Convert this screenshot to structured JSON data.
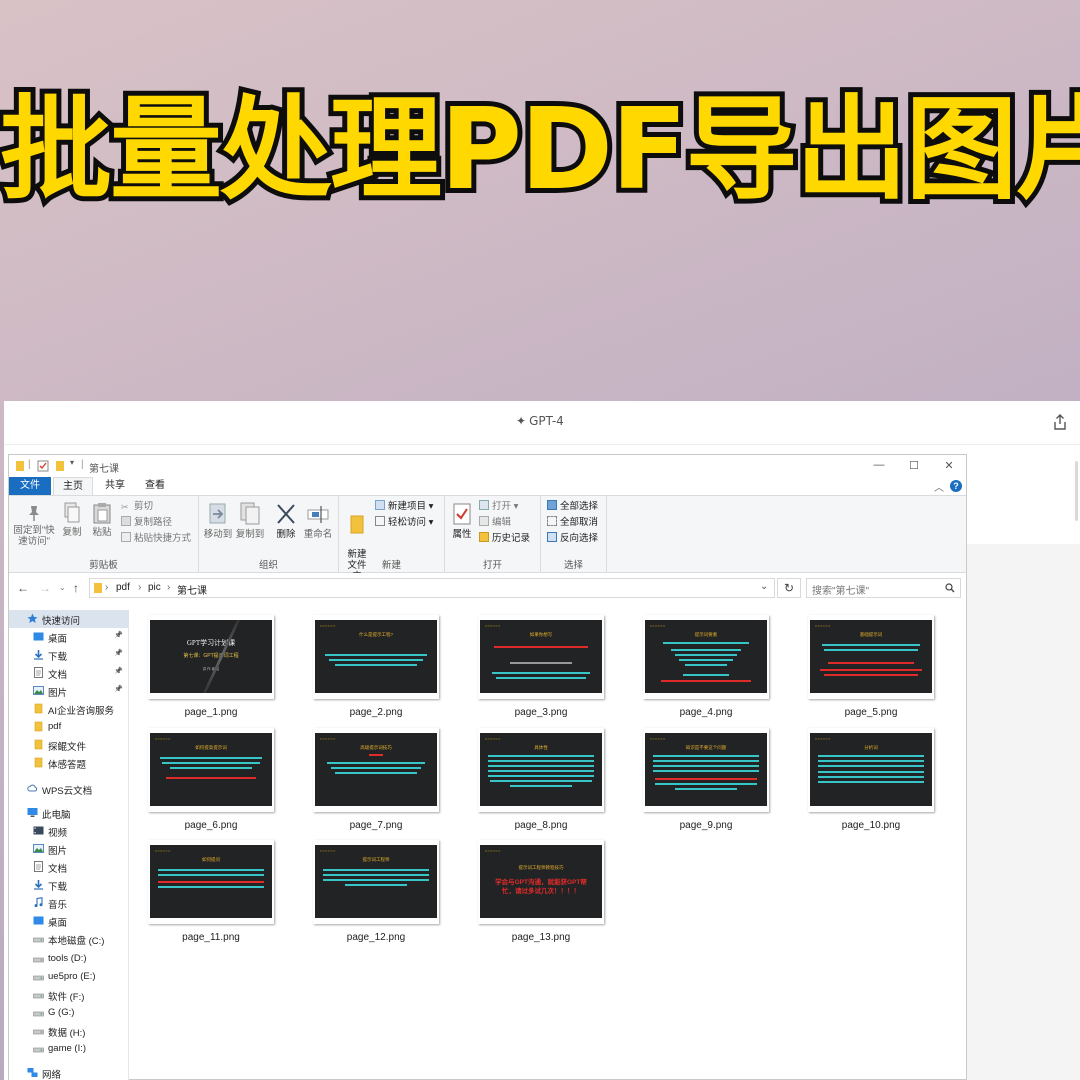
{
  "headline": "批量处理PDF导出图片",
  "app": {
    "model_label": "GPT-4",
    "model_icon": "sparkle-icon",
    "share_icon": "share-icon"
  },
  "explorer": {
    "title": "第七课",
    "tabs": [
      "文件",
      "主页",
      "共享",
      "查看"
    ],
    "ribbon": {
      "clipboard": {
        "pin_label": "固定到\"快速访问\"",
        "copy_label": "复制",
        "paste_label": "粘贴",
        "cut_label": "剪切",
        "copy_path_label": "复制路径",
        "paste_shortcut_label": "粘贴快捷方式",
        "group_label": "剪贴板"
      },
      "organize": {
        "move_to_label": "移动到",
        "copy_to_label": "复制到",
        "delete_label": "删除",
        "rename_label": "重命名",
        "group_label": "组织"
      },
      "new": {
        "new_folder_label": "新建\n文件夹",
        "new_item_label": "新建项目 ▾",
        "easy_access_label": "轻松访问 ▾",
        "group_label": "新建"
      },
      "open": {
        "properties_label": "属性",
        "open_label": "打开 ▾",
        "edit_label": "编辑",
        "history_label": "历史记录",
        "group_label": "打开"
      },
      "select": {
        "select_all_label": "全部选择",
        "select_none_label": "全部取消",
        "invert_label": "反向选择",
        "group_label": "选择"
      }
    },
    "address": {
      "crumbs": [
        "pdf",
        "pic",
        "第七课"
      ],
      "search_placeholder": "搜索\"第七课\""
    },
    "sidebar": [
      {
        "label": "快速访问",
        "icon": "star-icon",
        "pinned": false,
        "level": 0,
        "active": true
      },
      {
        "label": "桌面",
        "icon": "desktop-icon",
        "pinned": true,
        "level": 1
      },
      {
        "label": "下载",
        "icon": "download-icon",
        "pinned": true,
        "level": 1
      },
      {
        "label": "文档",
        "icon": "document-icon",
        "pinned": true,
        "level": 1
      },
      {
        "label": "图片",
        "icon": "picture-icon",
        "pinned": true,
        "level": 1
      },
      {
        "label": "AI企业咨询服务",
        "icon": "folder-icon",
        "pinned": false,
        "level": 1
      },
      {
        "label": "pdf",
        "icon": "folder-icon",
        "pinned": false,
        "level": 1
      },
      {
        "label": "探鲲文件",
        "icon": "folder-icon",
        "pinned": false,
        "level": 1
      },
      {
        "label": "体感答题",
        "icon": "folder-icon",
        "pinned": false,
        "level": 1
      },
      {
        "label": "WPS云文档",
        "icon": "cloud-icon",
        "pinned": false,
        "level": 0
      },
      {
        "label": "此电脑",
        "icon": "computer-icon",
        "pinned": false,
        "level": 0
      },
      {
        "label": "视频",
        "icon": "video-icon",
        "pinned": false,
        "level": 1
      },
      {
        "label": "图片",
        "icon": "picture-icon",
        "pinned": false,
        "level": 1
      },
      {
        "label": "文档",
        "icon": "document-icon",
        "pinned": false,
        "level": 1
      },
      {
        "label": "下载",
        "icon": "download-icon",
        "pinned": false,
        "level": 1
      },
      {
        "label": "音乐",
        "icon": "music-icon",
        "pinned": false,
        "level": 1
      },
      {
        "label": "桌面",
        "icon": "desktop-icon",
        "pinned": false,
        "level": 1
      },
      {
        "label": "本地磁盘 (C:)",
        "icon": "drive-icon",
        "pinned": false,
        "level": 1
      },
      {
        "label": "tools (D:)",
        "icon": "drive-icon",
        "pinned": false,
        "level": 1
      },
      {
        "label": "ue5pro (E:)",
        "icon": "drive-icon",
        "pinned": false,
        "level": 1
      },
      {
        "label": "软件 (F:)",
        "icon": "drive-icon",
        "pinned": false,
        "level": 1
      },
      {
        "label": "G (G:)",
        "icon": "drive-icon",
        "pinned": false,
        "level": 1
      },
      {
        "label": "数据 (H:)",
        "icon": "drive-icon",
        "pinned": false,
        "level": 1
      },
      {
        "label": "game (I:)",
        "icon": "drive-icon",
        "pinned": false,
        "level": 1
      },
      {
        "label": "网络",
        "icon": "network-icon",
        "pinned": false,
        "level": 0
      }
    ],
    "files": [
      {
        "name": "page_1.png",
        "slide": {
          "kind": "cover",
          "title": "GPT学习计划课",
          "subtitle": "第七课：GPT提示词工程",
          "note": "讲 作 者 名"
        }
      },
      {
        "name": "page_2.png",
        "slide": {
          "kind": "text",
          "title": "什么是提示工程?"
        }
      },
      {
        "name": "page_3.png",
        "slide": {
          "kind": "text",
          "title": "如果你想写"
        }
      },
      {
        "name": "page_4.png",
        "slide": {
          "kind": "text",
          "title": "提示词要素"
        }
      },
      {
        "name": "page_5.png",
        "slide": {
          "kind": "text",
          "title": "基础提示词"
        }
      },
      {
        "name": "page_6.png",
        "slide": {
          "kind": "text",
          "title": "如何提高提示词"
        }
      },
      {
        "name": "page_7.png",
        "slide": {
          "kind": "text",
          "title": "高级提示词技巧"
        }
      },
      {
        "name": "page_8.png",
        "slide": {
          "kind": "text",
          "title": "具体性"
        }
      },
      {
        "name": "page_9.png",
        "slide": {
          "kind": "text",
          "title": "知识是不要这个问题"
        }
      },
      {
        "name": "page_10.png",
        "slide": {
          "kind": "text",
          "title": "分析词"
        }
      },
      {
        "name": "page_11.png",
        "slide": {
          "kind": "text",
          "title": "如何提问"
        }
      },
      {
        "name": "page_12.png",
        "slide": {
          "kind": "text",
          "title": "提示词工程师"
        }
      },
      {
        "name": "page_13.png",
        "slide": {
          "kind": "final",
          "title": "提示词工程师教程技巧",
          "big": "学会与GPT沟通，就能获GPT帮忙，请过多试几次！！！！"
        }
      }
    ]
  },
  "colors": {
    "headline_fill": "#ffd800",
    "headline_stroke": "#0d0d0d",
    "file_tab": "#1a6ec2",
    "slide_bg": "#222324",
    "slide_title": "#e6b12b",
    "slide_red": "#e02b2b",
    "slide_cyan": "#38c5c8"
  }
}
